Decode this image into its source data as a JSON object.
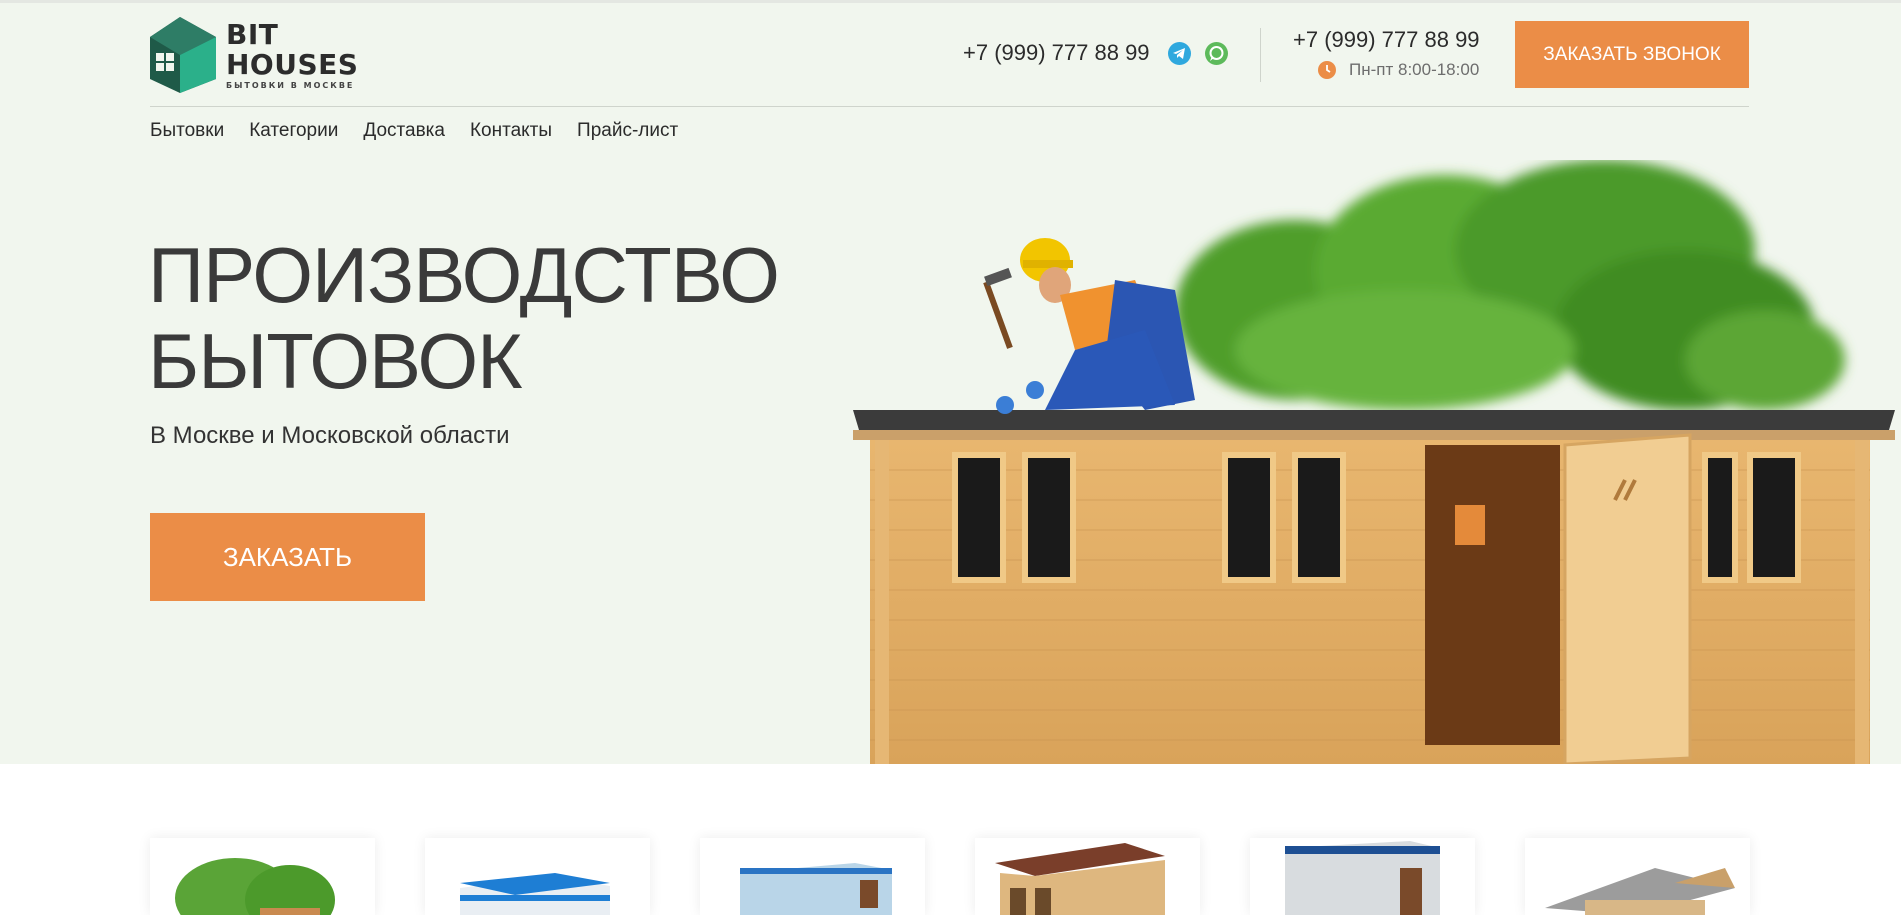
{
  "header": {
    "logo": {
      "title": "BIT HOUSES",
      "subtitle": "БЫТОВКИ В МОСКВЕ"
    },
    "phone_primary": "+7 (999) 777 88 99",
    "phone_secondary": "+7 (999) 777 88 99",
    "working_hours": "Пн-пт 8:00-18:00",
    "call_button_label": "ЗАКАЗАТЬ ЗВОНОК",
    "icons": {
      "telegram": "telegram-icon",
      "whatsapp": "whatsapp-icon",
      "clock": "clock-icon"
    }
  },
  "nav": {
    "items": [
      {
        "label": "Бытовки"
      },
      {
        "label": "Категории"
      },
      {
        "label": "Доставка"
      },
      {
        "label": "Контакты"
      },
      {
        "label": "Прайс-лист"
      }
    ]
  },
  "hero": {
    "title_line1": "ПРОИЗВОДСТВО",
    "title_line2": "БЫТОВОК",
    "subtitle": "В Москве и Московской области",
    "order_button_label": "ЗАКАЗАТЬ"
  },
  "colors": {
    "accent": "#eb8d47",
    "hero_background": "#f1f6ee",
    "logo_green_dark": "#1f5a48",
    "logo_green_light": "#2bb08a"
  },
  "products": [
    {
      "name": "product-card-garden-cabin"
    },
    {
      "name": "product-card-blue-block"
    },
    {
      "name": "product-card-container"
    },
    {
      "name": "product-card-wooden-cabin"
    },
    {
      "name": "product-card-metal-cabin"
    },
    {
      "name": "product-card-house"
    }
  ]
}
